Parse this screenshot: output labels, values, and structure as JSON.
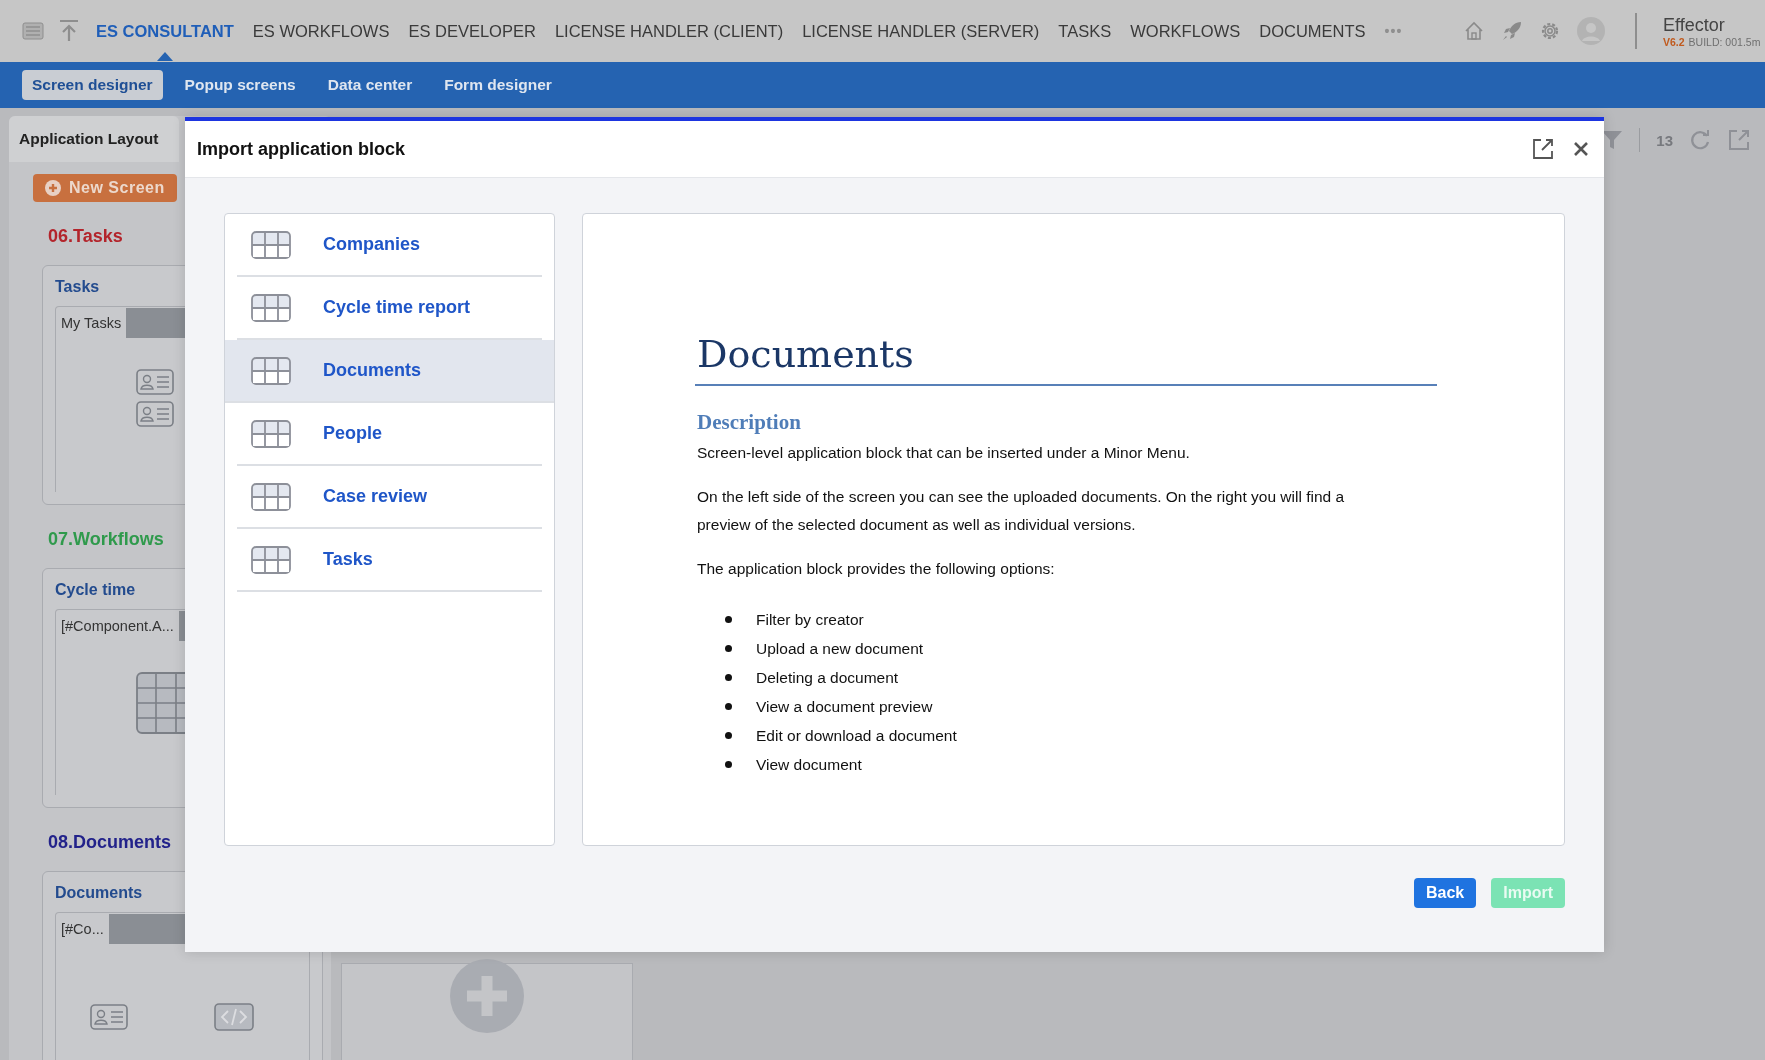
{
  "top_nav": {
    "items": [
      {
        "label": "ES CONSULTANT",
        "selected": true
      },
      {
        "label": "ES WORKFLOWS",
        "selected": false
      },
      {
        "label": "ES DEVELOPER",
        "selected": false
      },
      {
        "label": "LICENSE HANDLER (CLIENT)",
        "selected": false
      },
      {
        "label": "LICENSE HANDLER (SERVER)",
        "selected": false
      },
      {
        "label": "TASKS",
        "selected": false
      },
      {
        "label": "WORKFLOWS",
        "selected": false
      },
      {
        "label": "DOCUMENTS",
        "selected": false
      }
    ],
    "more": "•••",
    "app": {
      "name": "Effector",
      "version": "V6.2",
      "build": "BUILD: 001.5m"
    }
  },
  "sub_nav": [
    {
      "label": "Screen designer",
      "selected": true
    },
    {
      "label": "Popup screens",
      "selected": false
    },
    {
      "label": "Data center",
      "selected": false
    },
    {
      "label": "Form designer",
      "selected": false
    }
  ],
  "layout_panel": {
    "tab": "Application Layout",
    "new_button": "New Screen",
    "sections": [
      {
        "title": "06.Tasks",
        "color": "#b3242b",
        "card_title": "Tasks",
        "field": "My Tasks",
        "kind": "cards"
      },
      {
        "title": "07.Workflows",
        "color": "#2f9a4c",
        "card_title": "Cycle time",
        "field": "[#Component.A...",
        "kind": "grid"
      },
      {
        "title": "08.Documents",
        "color": "#22228a",
        "card_title": "Documents",
        "field": "[#Co...",
        "kind": "split"
      }
    ]
  },
  "toolbar": {
    "count": "13"
  },
  "modal": {
    "title": "Import application block",
    "blocks": [
      {
        "label": "Companies",
        "selected": false
      },
      {
        "label": "Cycle time report",
        "selected": false
      },
      {
        "label": "Documents",
        "selected": true
      },
      {
        "label": "People",
        "selected": false
      },
      {
        "label": "Case review",
        "selected": false
      },
      {
        "label": "Tasks",
        "selected": false
      }
    ],
    "preview": {
      "title": "Documents",
      "heading": "Description",
      "paragraphs": [
        "Screen-level application block that can be inserted under a Minor Menu.",
        "On the left side of the screen you can see the uploaded documents. On the right you will find a preview of the selected document as well as individual versions.",
        "The application block provides the following options:"
      ],
      "options": [
        "Filter by creator",
        "Upload a new document",
        "Deleting a document",
        "View a document preview",
        "Edit or download a document",
        "View document"
      ]
    },
    "buttons": [
      {
        "label": "Back",
        "disabled": false
      },
      {
        "label": "Import",
        "disabled": true
      }
    ]
  }
}
